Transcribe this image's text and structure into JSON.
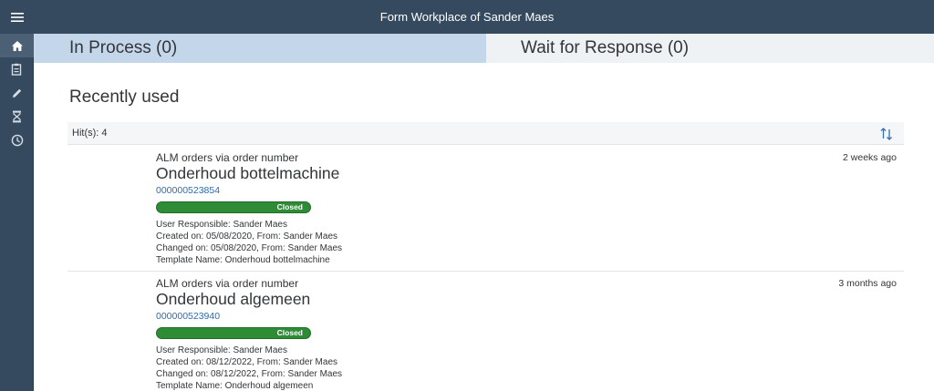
{
  "shell": {
    "title": "Form Workplace of Sander Maes",
    "menu_icon": "hamburger-icon"
  },
  "sidenav": {
    "items": [
      {
        "icon": "home-icon",
        "active": true
      },
      {
        "icon": "form-icon",
        "active": false
      },
      {
        "icon": "pencil-icon",
        "active": false
      },
      {
        "icon": "hourglass-icon",
        "active": false
      },
      {
        "icon": "history-icon",
        "active": false
      }
    ]
  },
  "tabs": [
    {
      "label": "In Process (0)",
      "selected": true
    },
    {
      "label": "Wait for Response (0)",
      "selected": false
    }
  ],
  "section": {
    "title": "Recently used"
  },
  "list": {
    "hits_label": "Hit(s): 4",
    "sort_icon": "sort-icon",
    "items": [
      {
        "type": "ALM orders via order number",
        "title": "Onderhoud bottelmachine",
        "number": "000000523854",
        "status": "Closed",
        "status_progress": 1.0,
        "responsible": "User Responsible: Sander Maes",
        "created": "Created on: 05/08/2020, From: Sander Maes",
        "changed": "Changed on: 05/08/2020, From: Sander Maes",
        "template": "Template Name: Onderhoud bottelmachine",
        "time": "2 weeks ago"
      },
      {
        "type": "ALM orders via order number",
        "title": "Onderhoud algemeen",
        "number": "000000523940",
        "status": "Closed",
        "status_progress": 1.0,
        "responsible": "User Responsible: Sander Maes",
        "created": "Created on: 08/12/2022, From: Sander Maes",
        "changed": "Changed on: 08/12/2022, From: Sander Maes",
        "template": "Template Name: Onderhoud algemeen",
        "time": "3 months ago"
      }
    ]
  },
  "colors": {
    "shell": "#354a5f",
    "tab_selected": "#c4d7ea",
    "tab_unselected": "#eef2f5",
    "link": "#2d6bb1",
    "status_closed": "#2e8b36"
  }
}
